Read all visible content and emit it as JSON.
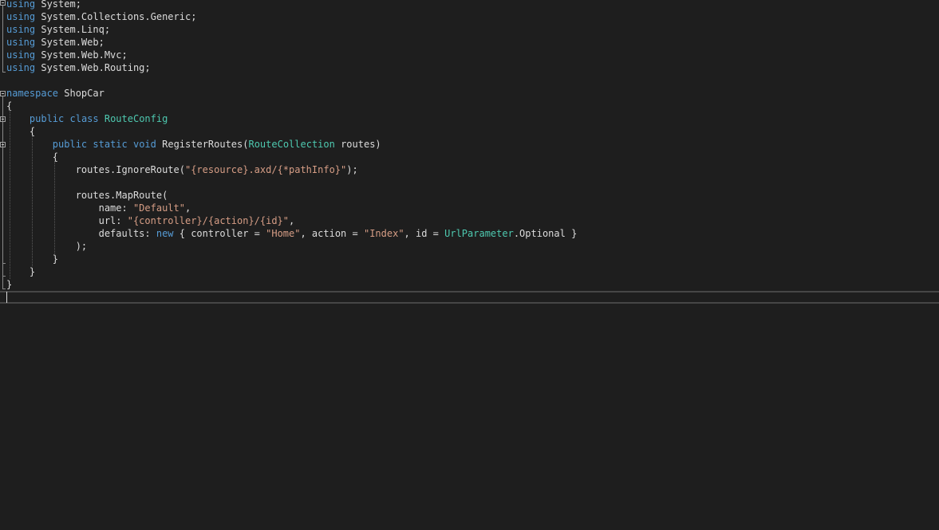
{
  "editor": {
    "lines": [
      {
        "tokens": [
          {
            "c": "kw",
            "t": "using"
          },
          {
            "c": "plain",
            "t": " System;"
          }
        ]
      },
      {
        "tokens": [
          {
            "c": "kw",
            "t": "using"
          },
          {
            "c": "plain",
            "t": " System.Collections.Generic;"
          }
        ]
      },
      {
        "tokens": [
          {
            "c": "kw",
            "t": "using"
          },
          {
            "c": "plain",
            "t": " System.Linq;"
          }
        ]
      },
      {
        "tokens": [
          {
            "c": "kw",
            "t": "using"
          },
          {
            "c": "plain",
            "t": " System.Web;"
          }
        ]
      },
      {
        "tokens": [
          {
            "c": "kw",
            "t": "using"
          },
          {
            "c": "plain",
            "t": " System.Web.Mvc;"
          }
        ]
      },
      {
        "tokens": [
          {
            "c": "kw",
            "t": "using"
          },
          {
            "c": "plain",
            "t": " System.Web.Routing;"
          }
        ]
      },
      {
        "tokens": []
      },
      {
        "tokens": [
          {
            "c": "kw",
            "t": "namespace"
          },
          {
            "c": "plain",
            "t": " ShopCar"
          }
        ]
      },
      {
        "tokens": [
          {
            "c": "plain",
            "t": "{"
          }
        ]
      },
      {
        "tokens": [
          {
            "c": "plain",
            "t": "    "
          },
          {
            "c": "kw",
            "t": "public"
          },
          {
            "c": "plain",
            "t": " "
          },
          {
            "c": "kw",
            "t": "class"
          },
          {
            "c": "plain",
            "t": " "
          },
          {
            "c": "type",
            "t": "RouteConfig"
          }
        ]
      },
      {
        "tokens": [
          {
            "c": "plain",
            "t": "    {"
          }
        ]
      },
      {
        "tokens": [
          {
            "c": "plain",
            "t": "        "
          },
          {
            "c": "kw",
            "t": "public"
          },
          {
            "c": "plain",
            "t": " "
          },
          {
            "c": "kw",
            "t": "static"
          },
          {
            "c": "plain",
            "t": " "
          },
          {
            "c": "kw",
            "t": "void"
          },
          {
            "c": "plain",
            "t": " RegisterRoutes("
          },
          {
            "c": "type",
            "t": "RouteCollection"
          },
          {
            "c": "plain",
            "t": " routes)"
          }
        ]
      },
      {
        "tokens": [
          {
            "c": "plain",
            "t": "        {"
          }
        ]
      },
      {
        "tokens": [
          {
            "c": "plain",
            "t": "            routes.IgnoreRoute("
          },
          {
            "c": "str",
            "t": "\"{resource}.axd/{*pathInfo}\""
          },
          {
            "c": "plain",
            "t": ");"
          }
        ]
      },
      {
        "tokens": []
      },
      {
        "tokens": [
          {
            "c": "plain",
            "t": "            routes.MapRoute("
          }
        ]
      },
      {
        "tokens": [
          {
            "c": "plain",
            "t": "                name: "
          },
          {
            "c": "str",
            "t": "\"Default\""
          },
          {
            "c": "plain",
            "t": ","
          }
        ]
      },
      {
        "tokens": [
          {
            "c": "plain",
            "t": "                url: "
          },
          {
            "c": "str",
            "t": "\"{controller}/{action}/{id}\""
          },
          {
            "c": "plain",
            "t": ","
          }
        ]
      },
      {
        "tokens": [
          {
            "c": "plain",
            "t": "                defaults: "
          },
          {
            "c": "kw",
            "t": "new"
          },
          {
            "c": "plain",
            "t": " { controller = "
          },
          {
            "c": "str",
            "t": "\"Home\""
          },
          {
            "c": "plain",
            "t": ", action = "
          },
          {
            "c": "str",
            "t": "\"Index\""
          },
          {
            "c": "plain",
            "t": ", id = "
          },
          {
            "c": "type",
            "t": "UrlParameter"
          },
          {
            "c": "plain",
            "t": ".Optional }"
          }
        ]
      },
      {
        "tokens": [
          {
            "c": "plain",
            "t": "            );"
          }
        ]
      },
      {
        "tokens": [
          {
            "c": "plain",
            "t": "        }"
          }
        ]
      },
      {
        "tokens": [
          {
            "c": "plain",
            "t": "    }"
          }
        ]
      },
      {
        "tokens": [
          {
            "c": "plain",
            "t": "}"
          }
        ]
      },
      {
        "tokens": []
      }
    ]
  },
  "colors": {
    "background": "#1e1e1e",
    "keyword": "#569cd6",
    "type": "#4ec9b0",
    "string": "#d69d85",
    "text": "#dcdcdc"
  }
}
